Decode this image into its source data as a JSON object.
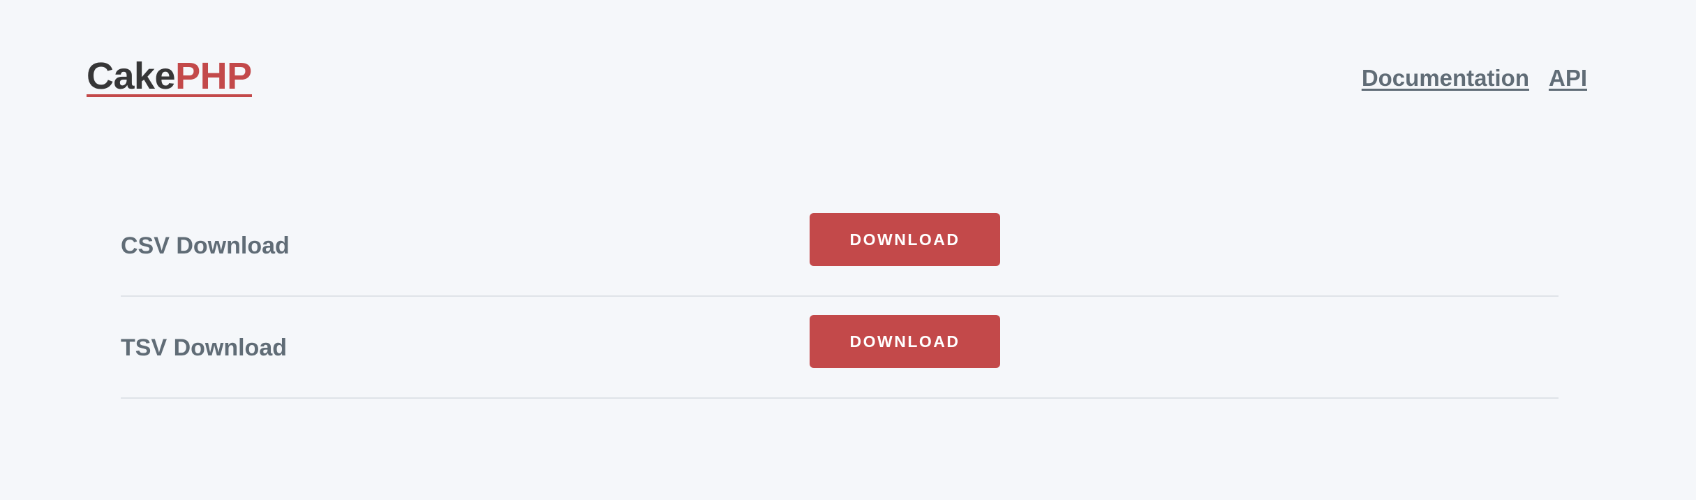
{
  "header": {
    "brand_part1": "Cake",
    "brand_part2": "PHP",
    "nav": [
      {
        "label": "Documentation"
      },
      {
        "label": "API"
      }
    ]
  },
  "downloads": [
    {
      "label": "CSV Download",
      "button_label": "DOWNLOAD"
    },
    {
      "label": "TSV Download",
      "button_label": "DOWNLOAD"
    }
  ],
  "colors": {
    "background": "#f5f7fa",
    "brand_red": "#c3494a",
    "brand_dark": "#363637",
    "text_gray": "#606c76",
    "divider": "#dfe3e8"
  }
}
